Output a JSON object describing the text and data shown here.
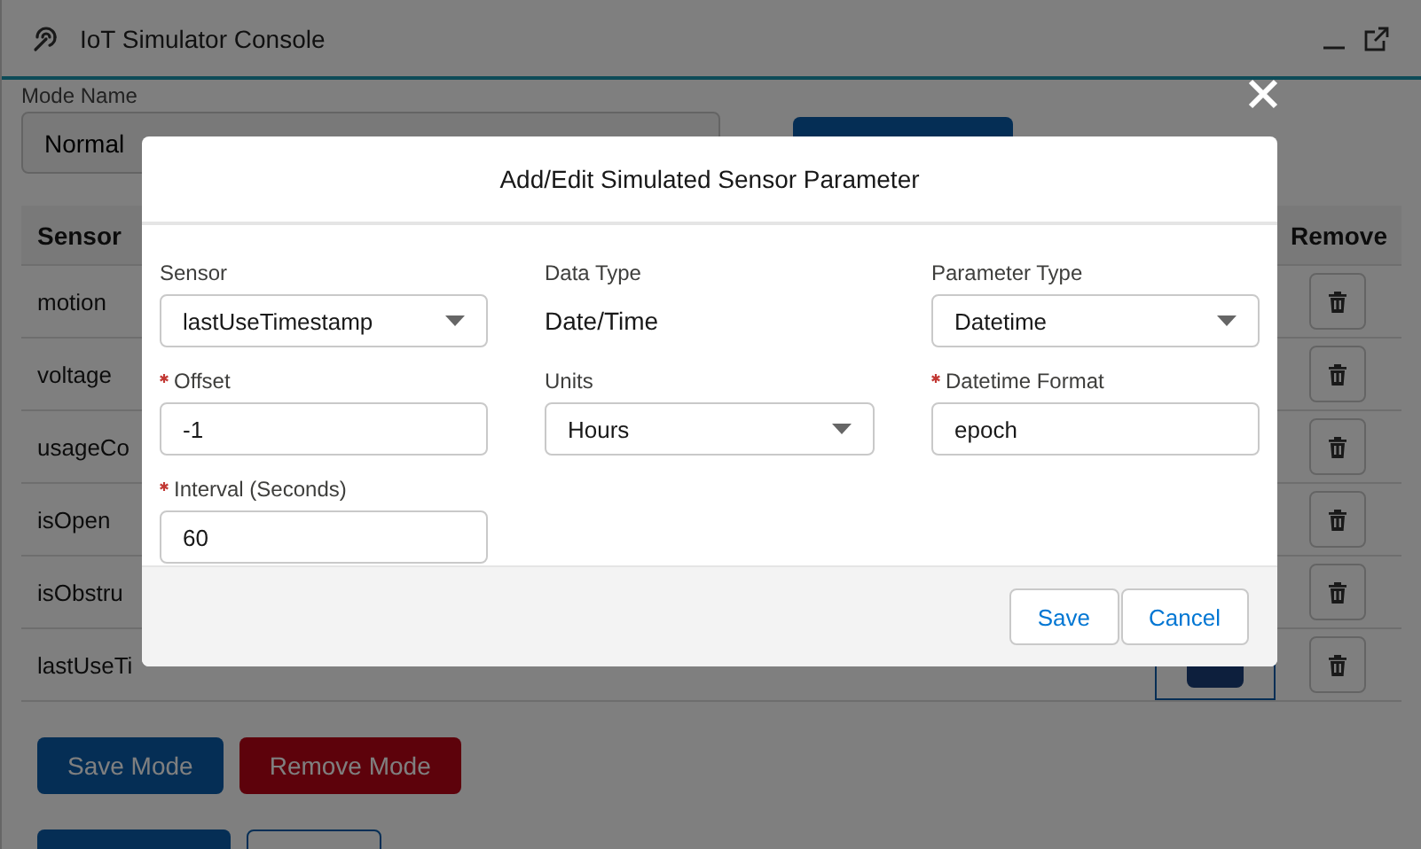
{
  "window": {
    "title": "IoT Simulator Console"
  },
  "mode_name": {
    "label": "Mode Name",
    "value": "Normal"
  },
  "table": {
    "columns": [
      "Sensor",
      "Remove"
    ],
    "rows": [
      {
        "sensor": "motion",
        "editing": false
      },
      {
        "sensor": "voltage",
        "editing": false
      },
      {
        "sensor": "usageCo",
        "editing": false
      },
      {
        "sensor": "isOpen",
        "editing": false
      },
      {
        "sensor": "isObstru",
        "editing": false
      },
      {
        "sensor": "lastUseTi",
        "editing": true
      }
    ]
  },
  "actions": [
    {
      "label": "Save Mode",
      "kind": "primary"
    },
    {
      "label": "Remove Mode",
      "kind": "danger"
    }
  ],
  "footer_actions": [
    {
      "kind": "primary"
    },
    {
      "kind": "outline"
    }
  ],
  "modal": {
    "title": "Add/Edit Simulated Sensor Parameter",
    "fields": [
      {
        "label": "Sensor",
        "kind": "select",
        "value": "lastUseTimestamp",
        "required": false
      },
      {
        "label": "Data Type",
        "kind": "text",
        "value": "Date/Time",
        "required": false
      },
      {
        "label": "Parameter Type",
        "kind": "select",
        "value": "Datetime",
        "required": false
      },
      {
        "label": "Offset",
        "kind": "input",
        "value": "-1",
        "required": true
      },
      {
        "label": "Units",
        "kind": "select",
        "value": "Hours",
        "required": false
      },
      {
        "label": "Datetime Format",
        "kind": "input",
        "value": "epoch",
        "required": true
      },
      {
        "label": "Interval (Seconds)",
        "kind": "input",
        "value": "60",
        "required": true
      }
    ],
    "buttons": [
      "Save",
      "Cancel"
    ]
  }
}
